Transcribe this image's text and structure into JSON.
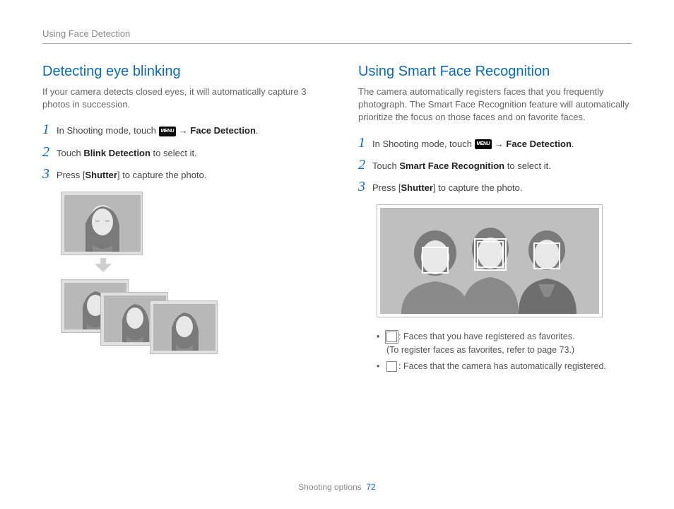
{
  "header": {
    "breadcrumb": "Using Face Detection"
  },
  "left": {
    "title": "Detecting eye blinking",
    "intro": "If your camera detects closed eyes, it will automatically capture 3 photos in succession.",
    "steps": [
      {
        "num": "1",
        "prefix": "In Shooting mode, touch ",
        "menu": "MENU",
        "arrow": " → ",
        "target": "Face Detection",
        "suffix": "."
      },
      {
        "num": "2",
        "prefix": "Touch ",
        "target": "Blink Detection",
        "suffix": " to select it."
      },
      {
        "num": "3",
        "prefix": "Press [",
        "target": "Shutter",
        "suffix": "] to capture the photo."
      }
    ]
  },
  "right": {
    "title": "Using Smart Face Recognition",
    "intro": "The camera automatically registers faces that you frequently photograph. The Smart Face Recognition feature will automatically prioritize the focus on those faces and on favorite faces.",
    "steps": [
      {
        "num": "1",
        "prefix": "In Shooting mode, touch ",
        "menu": "MENU",
        "arrow": " → ",
        "target": "Face Detection",
        "suffix": "."
      },
      {
        "num": "2",
        "prefix": "Touch ",
        "target": "Smart Face Recognition",
        "suffix": " to select it."
      },
      {
        "num": "3",
        "prefix": "Press [",
        "target": "Shutter",
        "suffix": "] to capture the photo."
      }
    ],
    "bullets": {
      "b1a": ": Faces that you have registered as favorites.",
      "b1b": "(To register faces as favorites, refer to page 73.)",
      "b2": ": Faces that the camera has automatically registered."
    }
  },
  "footer": {
    "section": "Shooting options",
    "page": "72"
  }
}
